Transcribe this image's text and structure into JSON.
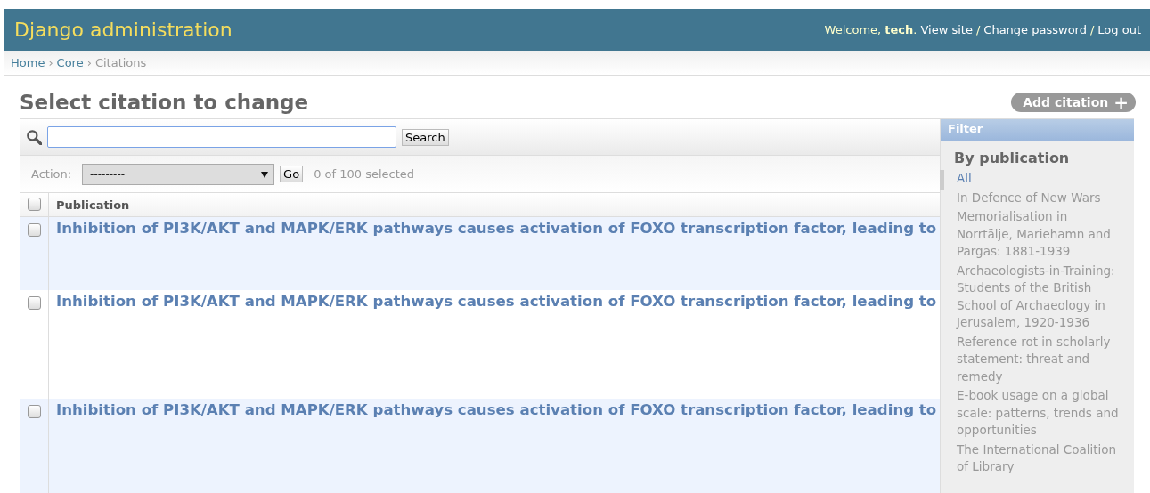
{
  "header": {
    "title": "Django administration",
    "welcome": "Welcome,",
    "user": "tech",
    "user_after": ".",
    "links": [
      "View site",
      "Change password",
      "Log out"
    ],
    "separator": "/"
  },
  "breadcrumbs": [
    {
      "label": "Home",
      "link": true
    },
    {
      "label": "Core",
      "link": true
    },
    {
      "label": "Citations",
      "link": false
    }
  ],
  "breadcrumb_separator": "›",
  "page_title": "Select citation to change",
  "add_button": {
    "label": "Add citation",
    "icon": "+"
  },
  "search": {
    "button": "Search"
  },
  "actions": {
    "label": "Action:",
    "value": "---------",
    "button": "Go",
    "counter": "0 of 100 selected"
  },
  "table": {
    "columns": [
      {
        "label": "Publication",
        "checked": false
      }
    ],
    "rows": [
      {
        "title": "Inhibition of PI3K/AKT and MAPK/ERK pathways causes activation of FOXO transcription factor, leading to",
        "checked": false
      },
      {
        "title": "Inhibition of PI3K/AKT and MAPK/ERK pathways causes activation of FOXO transcription factor, leading to",
        "checked": false
      },
      {
        "title": "Inhibition of PI3K/AKT and MAPK/ERK pathways causes activation of FOXO transcription factor, leading to",
        "checked": false
      }
    ]
  },
  "filter": {
    "title": "Filter",
    "heading": "By publication",
    "items": [
      {
        "label": "All",
        "selected": true
      },
      {
        "label": "In Defence of New Wars",
        "selected": false
      },
      {
        "label": "Memorialisation in Norrtälje, Mariehamn and Pargas: 1881-1939",
        "selected": false
      },
      {
        "label": "Archaeologists-in-Training: Students of the British School of Archaeology in Jerusalem, 1920-1936",
        "selected": false
      },
      {
        "label": "Reference rot in scholarly statement: threat and remedy",
        "selected": false
      },
      {
        "label": "E-book usage on a global scale: patterns, trends and opportunities",
        "selected": false
      },
      {
        "label": "The International Coalition of Library",
        "selected": false
      }
    ]
  }
}
